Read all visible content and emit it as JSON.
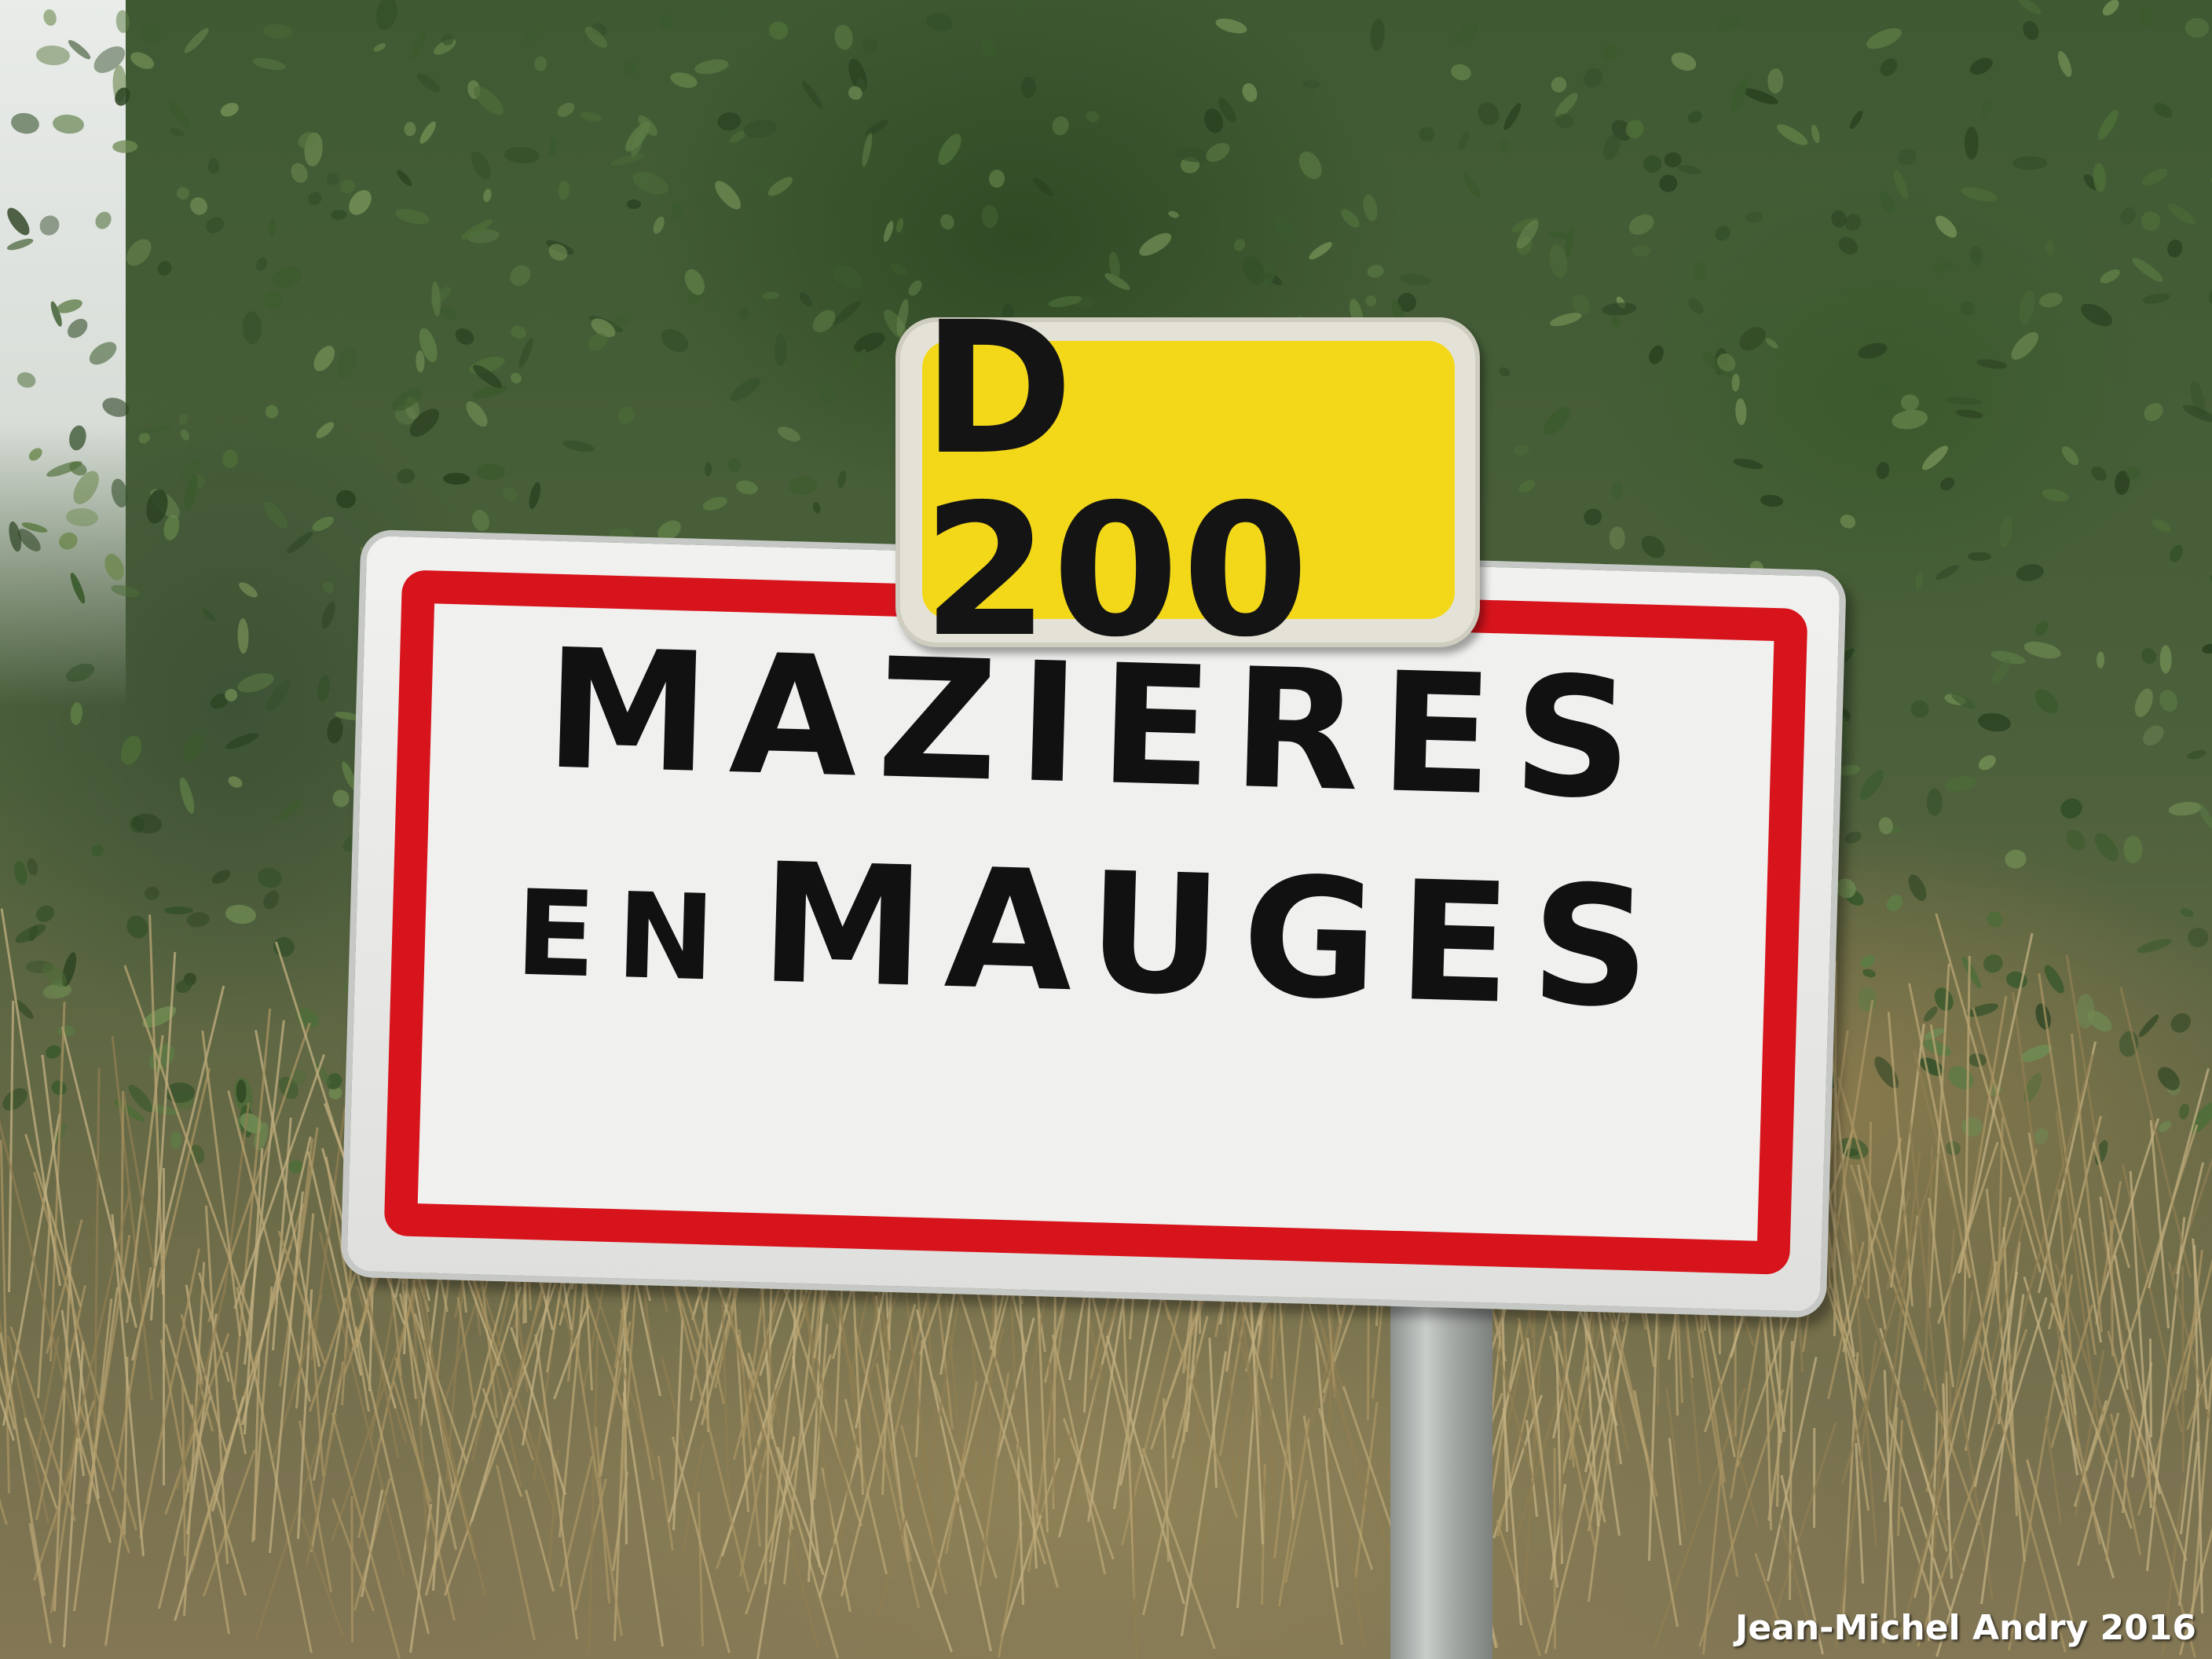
{
  "photo": {
    "subject": "French town entry road sign in front of a hedge",
    "route_plate": {
      "text": "D 200",
      "background_color": "#f3d81a",
      "text_color": "#141414"
    },
    "town_sign": {
      "line1": "MAZIERES",
      "line2_prefix": "EN",
      "line2_name": "MAUGES",
      "border_color": "#d7141c",
      "background_color": "#f0f0ee",
      "text_color": "#111111"
    },
    "credit": "Jean-Michel Andry 2016"
  }
}
